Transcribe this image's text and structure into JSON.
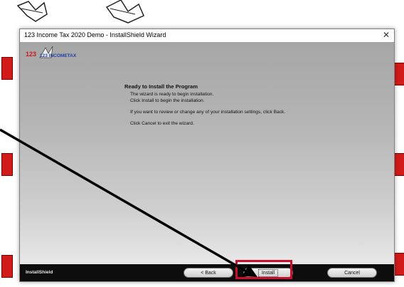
{
  "window": {
    "title": "123 Income Tax 2020 Demo - InstallShield Wizard",
    "close_glyph": "✕"
  },
  "logo": {
    "text": "123 INCOMETAX"
  },
  "content": {
    "heading": "Ready to Install the Program",
    "line1": "The wizard is ready to begin installation.",
    "line2": "Click Install to begin the installation.",
    "line3": "If you want to review or change any of your installation settings, click Back.",
    "line4": "Click Cancel to exit the wizard."
  },
  "footer": {
    "brand": "InstallShield",
    "back_label": "< Back",
    "install_label": "Install",
    "cancel_label": "Cancel"
  },
  "colors": {
    "highlight": "#c8102e",
    "logo_red": "#d11a1a",
    "logo_blue": "#1f3fa8"
  }
}
